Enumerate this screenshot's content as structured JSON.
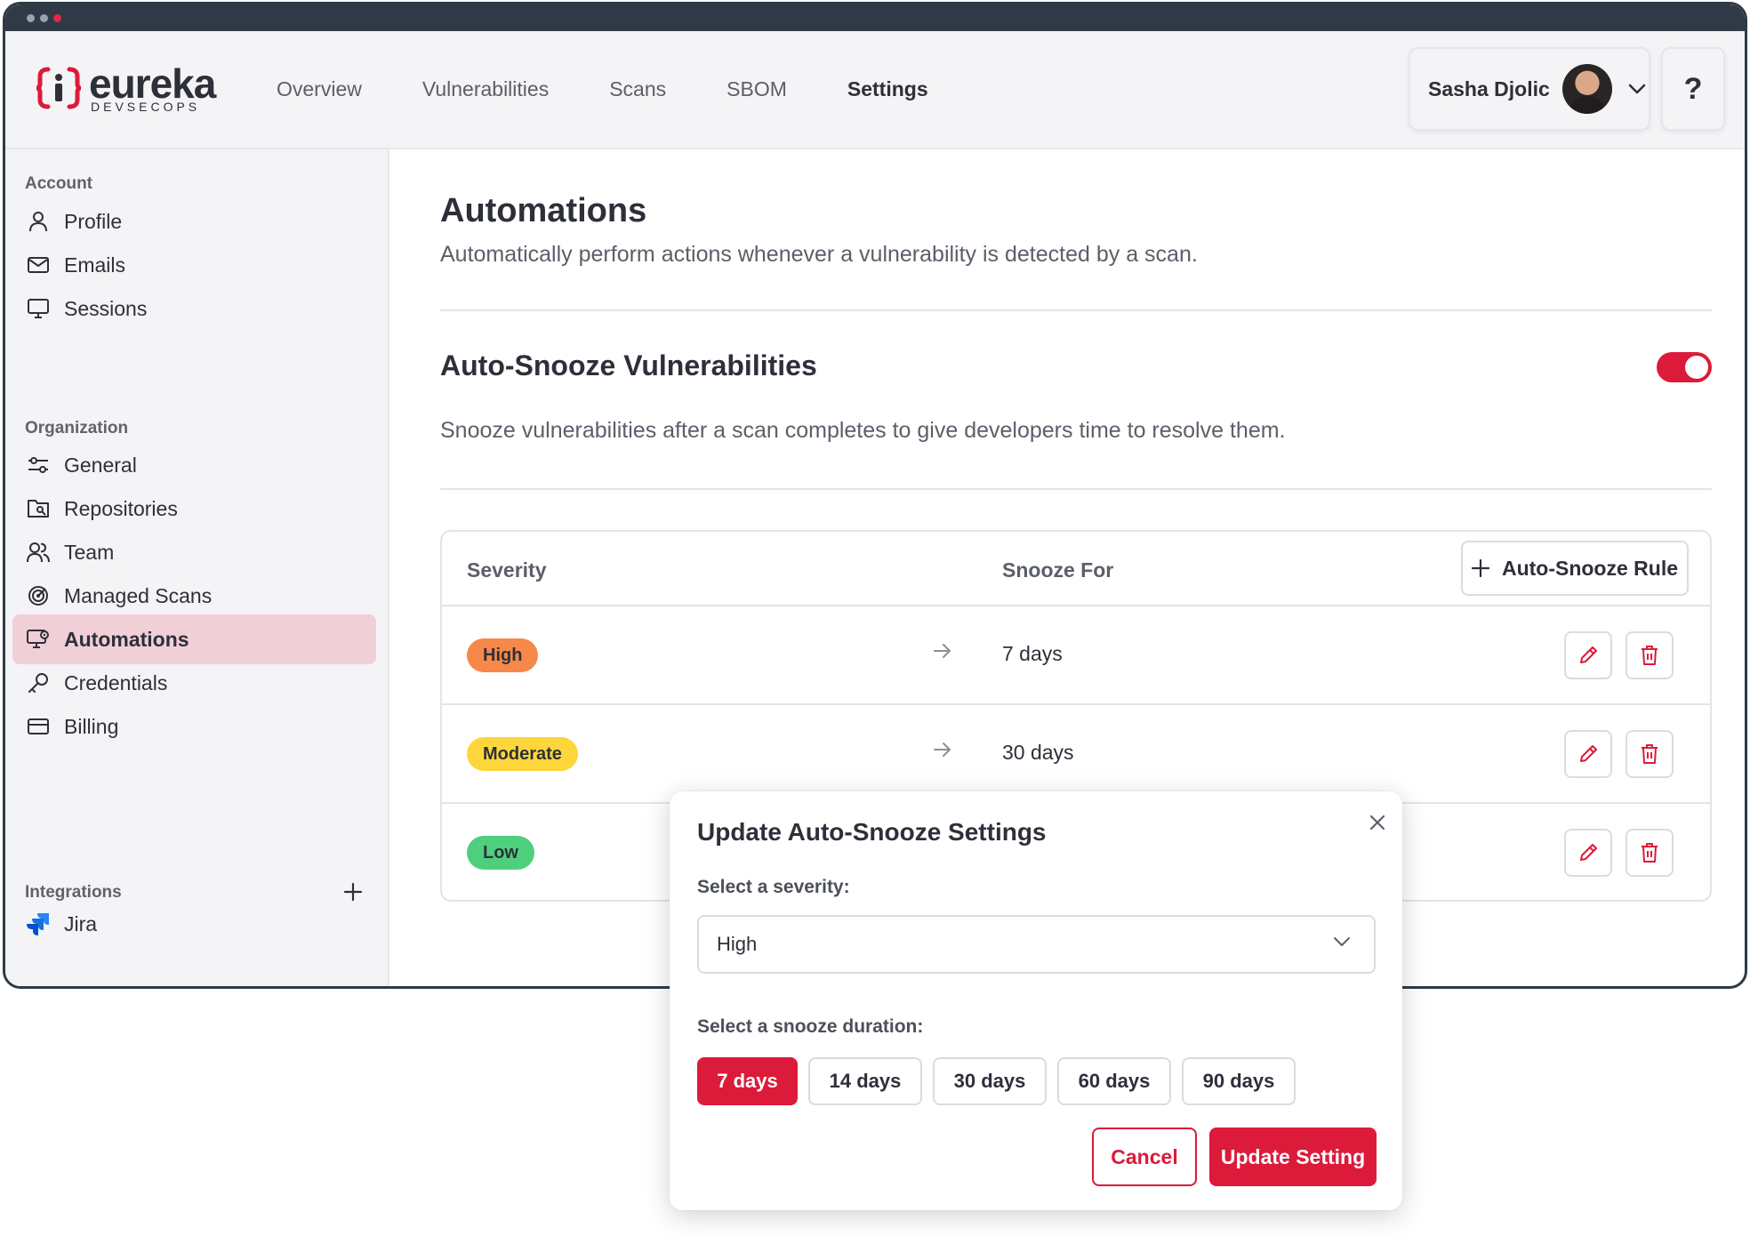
{
  "brand": {
    "name": "eureka",
    "tagline": "DEVSECOPS",
    "accent": "#dc1a3a"
  },
  "nav": {
    "links": [
      {
        "label": "Overview",
        "active": false
      },
      {
        "label": "Vulnerabilities",
        "active": false
      },
      {
        "label": "Scans",
        "active": false
      },
      {
        "label": "SBOM",
        "active": false
      },
      {
        "label": "Settings",
        "active": true
      }
    ],
    "user_name": "Sasha Djolic",
    "help_label": "?"
  },
  "sidebar": {
    "sections": {
      "account": "Account",
      "organization": "Organization",
      "integrations": "Integrations"
    },
    "account_items": [
      {
        "label": "Profile",
        "icon": "user-icon"
      },
      {
        "label": "Emails",
        "icon": "mail-icon"
      },
      {
        "label": "Sessions",
        "icon": "monitor-icon"
      }
    ],
    "organization_items": [
      {
        "label": "General",
        "icon": "sliders-icon"
      },
      {
        "label": "Repositories",
        "icon": "repository-icon"
      },
      {
        "label": "Team",
        "icon": "team-icon"
      },
      {
        "label": "Managed Scans",
        "icon": "radar-icon"
      },
      {
        "label": "Automations",
        "icon": "automation-icon",
        "active": true
      },
      {
        "label": "Credentials",
        "icon": "key-icon"
      },
      {
        "label": "Billing",
        "icon": "credit-card-icon"
      }
    ],
    "integration_items": [
      {
        "label": "Jira",
        "icon": "jira-icon"
      }
    ]
  },
  "page": {
    "title": "Automations",
    "subtitle": "Automatically perform actions whenever a vulnerability is detected by a scan.",
    "section_title": "Auto-Snooze Vulnerabilities",
    "section_subtitle": "Snooze vulnerabilities after a scan completes to give developers time to resolve them.",
    "toggle_on": true
  },
  "rules_table": {
    "headers": {
      "severity": "Severity",
      "snooze_for": "Snooze For"
    },
    "add_button": "Auto-Snooze Rule",
    "rows": [
      {
        "severity": "High",
        "duration": "7 days",
        "badge_bg": "#f6884a",
        "badge_fg": "#2d3039"
      },
      {
        "severity": "Moderate",
        "duration": "30 days",
        "badge_bg": "#fcd63a",
        "badge_fg": "#2d3039"
      },
      {
        "severity": "Low",
        "duration": "",
        "badge_bg": "#4fcf7e",
        "badge_fg": "#2d3039"
      }
    ]
  },
  "modal": {
    "title": "Update Auto-Snooze Settings",
    "severity_label": "Select a severity:",
    "severity_value": "High",
    "duration_label": "Select a snooze duration:",
    "durations": [
      {
        "label": "7 days",
        "selected": true
      },
      {
        "label": "14 days",
        "selected": false
      },
      {
        "label": "30 days",
        "selected": false
      },
      {
        "label": "60 days",
        "selected": false
      },
      {
        "label": "90 days",
        "selected": false
      }
    ],
    "cancel_label": "Cancel",
    "submit_label": "Update Setting"
  }
}
